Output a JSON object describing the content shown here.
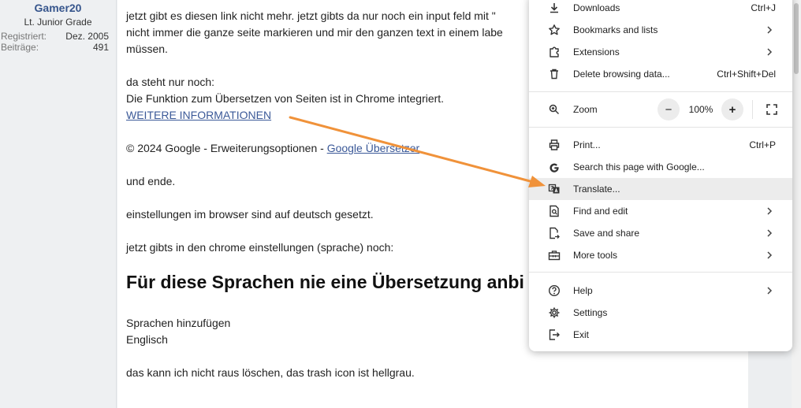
{
  "user": {
    "name": "Gamer20",
    "rank": "Lt. Junior Grade",
    "registered_label": "Registriert:",
    "registered_value": "Dez. 2005",
    "posts_label": "Beiträge:",
    "posts_value": "491"
  },
  "post": {
    "line1": "jetzt gibt es diesen link nicht mehr. jetzt gibts da nur noch ein input feld mit \"",
    "line2": "nicht immer die ganze seite markieren und mir den ganzen text in einem labe",
    "line3": "müssen.",
    "line4": "da steht nur noch:",
    "line5": "Die Funktion zum Übersetzen von Seiten ist in Chrome integriert.",
    "link_more": "WEITERE INFORMATIONEN",
    "copyright_text": "© 2024 Google - Erweiterungsoptionen - ",
    "link_translator": "Google Übersetzer",
    "line6": "und ende.",
    "line7": "einstellungen im browser sind auf deutsch gesetzt.",
    "line8": "jetzt gibts in den chrome einstellungen (sprache) noch:",
    "heading": "Für diese Sprachen nie eine Übersetzung anbi",
    "line9": "Sprachen hinzufügen",
    "line10": "Englisch",
    "line11": "das kann ich nicht raus löschen, das trash icon ist hellgrau."
  },
  "menu": {
    "downloads": {
      "label": "Downloads",
      "shortcut": "Ctrl+J",
      "icon": "download-icon"
    },
    "bookmarks": {
      "label": "Bookmarks and lists",
      "icon": "star-icon"
    },
    "extensions": {
      "label": "Extensions",
      "icon": "puzzle-icon"
    },
    "delete_data": {
      "label": "Delete browsing data...",
      "shortcut": "Ctrl+Shift+Del",
      "icon": "trash-icon"
    },
    "zoom": {
      "label": "Zoom",
      "value": "100%",
      "minus": "−",
      "plus": "+",
      "icon": "zoom-icon"
    },
    "print": {
      "label": "Print...",
      "shortcut": "Ctrl+P",
      "icon": "printer-icon"
    },
    "search_google": {
      "label": "Search this page with Google...",
      "icon": "google-g-icon"
    },
    "translate": {
      "label": "Translate...",
      "icon": "translate-icon"
    },
    "find_edit": {
      "label": "Find and edit",
      "icon": "find-page-icon"
    },
    "save_share": {
      "label": "Save and share",
      "icon": "save-share-icon"
    },
    "more_tools": {
      "label": "More tools",
      "icon": "toolbox-icon"
    },
    "help": {
      "label": "Help",
      "icon": "help-icon"
    },
    "settings": {
      "label": "Settings",
      "icon": "gear-icon"
    },
    "exit": {
      "label": "Exit",
      "icon": "exit-icon"
    }
  },
  "colors": {
    "link": "#3b5998",
    "username": "#36558c",
    "arrow": "#f0923a",
    "menu_highlight": "#ececec"
  }
}
